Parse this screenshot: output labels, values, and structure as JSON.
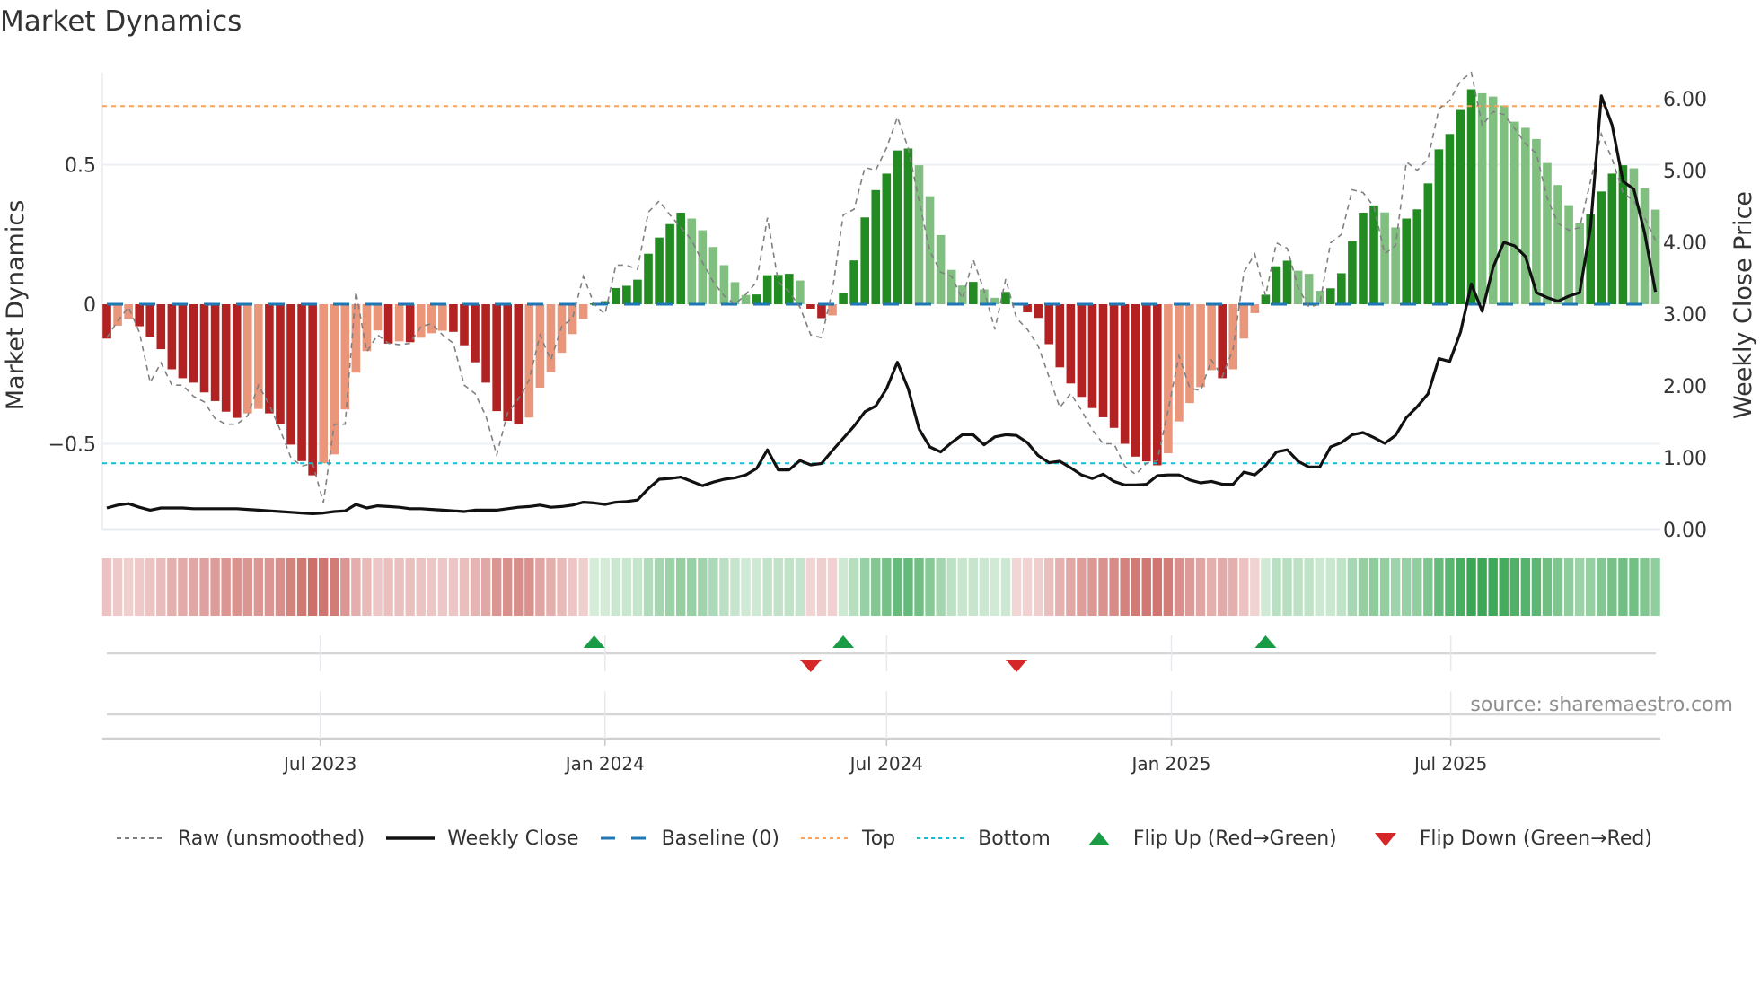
{
  "title": "Market Dynamics",
  "source": "source: sharemaestro.com",
  "colors": {
    "bar_neg_strong": "#b22222",
    "bar_neg_weak": "#e9967a",
    "bar_pos_strong": "#228b22",
    "bar_pos_weak": "#80bf80",
    "raw": "#808080",
    "close": "#111111",
    "baseline": "#1f77b4",
    "top": "#f4a460",
    "bottom": "#17becf",
    "flip_up": "#1a9c47",
    "flip_down": "#d62728"
  },
  "legend": [
    {
      "key": "raw",
      "label": "Raw (unsmoothed)"
    },
    {
      "key": "close",
      "label": "Weekly Close"
    },
    {
      "key": "baseline",
      "label": "Baseline (0)"
    },
    {
      "key": "top",
      "label": "Top"
    },
    {
      "key": "bottom",
      "label": "Bottom"
    },
    {
      "key": "flip_up",
      "label": "Flip Up (Red→Green)"
    },
    {
      "key": "flip_down",
      "label": "Flip Down (Green→Red)"
    }
  ],
  "chart_data": {
    "type": "bar",
    "title": "Market Dynamics",
    "start_date": "2023-02-13",
    "frequency": "weekly",
    "ylabel": "Market Dynamics",
    "y2label": "Weekly Close Price",
    "ylim": [
      -0.8,
      0.83
    ],
    "y2lim": [
      0,
      6.4
    ],
    "yticks": [
      {
        "v": 0.5,
        "label": "0.5"
      },
      {
        "v": 0,
        "label": "0"
      },
      {
        "v": -0.5,
        "label": "−0.5"
      }
    ],
    "y2ticks": [
      {
        "v": 6,
        "label": "6.00"
      },
      {
        "v": 5,
        "label": "5.00"
      },
      {
        "v": 4,
        "label": "4.00"
      },
      {
        "v": 3,
        "label": "3.00"
      },
      {
        "v": 2,
        "label": "2.00"
      },
      {
        "v": 1,
        "label": "1.00"
      },
      {
        "v": 0,
        "label": "0.00"
      }
    ],
    "xticks": [
      {
        "week": 19.71,
        "label": "Jul 2023"
      },
      {
        "week": 46.0,
        "label": "Jan 2024"
      },
      {
        "week": 72.0,
        "label": "Jul 2024"
      },
      {
        "week": 98.3,
        "label": "Jan 2025"
      },
      {
        "week": 124.1,
        "label": "Jul 2025"
      }
    ],
    "reference_lines": {
      "baseline": 0,
      "top": 0.71,
      "bottom": -0.57
    },
    "momentum": [
      -0.123,
      -0.077,
      -0.053,
      -0.079,
      -0.116,
      -0.161,
      -0.233,
      -0.265,
      -0.281,
      -0.316,
      -0.347,
      -0.385,
      -0.407,
      -0.391,
      -0.375,
      -0.391,
      -0.43,
      -0.503,
      -0.562,
      -0.613,
      -0.57,
      -0.538,
      -0.377,
      -0.245,
      -0.168,
      -0.094,
      -0.141,
      -0.133,
      -0.136,
      -0.12,
      -0.104,
      -0.095,
      -0.099,
      -0.147,
      -0.208,
      -0.281,
      -0.383,
      -0.418,
      -0.429,
      -0.406,
      -0.299,
      -0.243,
      -0.174,
      -0.107,
      -0.053,
      0.003,
      0.011,
      0.058,
      0.066,
      0.088,
      0.181,
      0.239,
      0.287,
      0.328,
      0.307,
      0.265,
      0.205,
      0.14,
      0.079,
      0.033,
      0.035,
      0.104,
      0.105,
      0.109,
      0.085,
      -0.016,
      -0.05,
      -0.04,
      0.04,
      0.157,
      0.311,
      0.409,
      0.468,
      0.551,
      0.558,
      0.498,
      0.387,
      0.248,
      0.123,
      0.067,
      0.08,
      0.053,
      0.023,
      0.044,
      -0.003,
      -0.029,
      -0.049,
      -0.143,
      -0.226,
      -0.284,
      -0.332,
      -0.372,
      -0.405,
      -0.443,
      -0.5,
      -0.546,
      -0.563,
      -0.577,
      -0.534,
      -0.42,
      -0.354,
      -0.297,
      -0.236,
      -0.265,
      -0.233,
      -0.123,
      -0.032,
      0.034,
      0.136,
      0.156,
      0.12,
      0.109,
      0.048,
      0.057,
      0.111,
      0.226,
      0.328,
      0.354,
      0.329,
      0.275,
      0.307,
      0.34,
      0.433,
      0.555,
      0.61,
      0.696,
      0.77,
      0.756,
      0.744,
      0.712,
      0.654,
      0.632,
      0.592,
      0.506,
      0.427,
      0.355,
      0.29,
      0.322,
      0.404,
      0.468,
      0.498,
      0.487,
      0.415,
      0.339
    ],
    "raw": [
      -0.12,
      -0.06,
      -0.01,
      -0.1,
      -0.28,
      -0.21,
      -0.29,
      -0.29,
      -0.33,
      -0.35,
      -0.41,
      -0.43,
      -0.43,
      -0.4,
      -0.29,
      -0.36,
      -0.45,
      -0.55,
      -0.58,
      -0.57,
      -0.71,
      -0.43,
      -0.43,
      0.045,
      -0.17,
      -0.11,
      -0.14,
      -0.145,
      -0.14,
      -0.08,
      -0.07,
      -0.11,
      -0.14,
      -0.29,
      -0.32,
      -0.4,
      -0.54,
      -0.39,
      -0.34,
      -0.27,
      -0.11,
      -0.2,
      -0.08,
      -0.05,
      0.1,
      0.0,
      -0.035,
      0.14,
      0.14,
      0.125,
      0.33,
      0.37,
      0.32,
      0.275,
      0.23,
      0.15,
      0.08,
      0.03,
      0.0,
      0.035,
      0.08,
      0.31,
      0.08,
      0.045,
      -0.01,
      -0.11,
      -0.12,
      0.05,
      0.32,
      0.34,
      0.49,
      0.48,
      0.56,
      0.67,
      0.56,
      0.37,
      0.19,
      0.115,
      0.1,
      0.02,
      0.16,
      0.05,
      -0.09,
      0.09,
      -0.05,
      -0.09,
      -0.15,
      -0.26,
      -0.37,
      -0.32,
      -0.38,
      -0.45,
      -0.5,
      -0.5,
      -0.58,
      -0.61,
      -0.57,
      -0.56,
      -0.38,
      -0.185,
      -0.3,
      -0.31,
      -0.2,
      -0.26,
      -0.16,
      0.115,
      0.18,
      0.03,
      0.22,
      0.2,
      0.06,
      -0.01,
      0.0,
      0.22,
      0.25,
      0.41,
      0.4,
      0.35,
      0.18,
      0.21,
      0.51,
      0.48,
      0.52,
      0.7,
      0.73,
      0.8,
      0.83,
      0.64,
      0.69,
      0.68,
      0.63,
      0.575,
      0.54,
      0.38,
      0.29,
      0.265,
      0.275,
      0.44,
      0.61,
      0.52,
      0.4,
      0.37,
      0.31,
      0.23
    ],
    "weekly_close": [
      0.3,
      0.34,
      0.36,
      0.31,
      0.27,
      0.3,
      0.3,
      0.3,
      0.29,
      0.29,
      0.29,
      0.29,
      0.29,
      0.28,
      0.27,
      0.26,
      0.25,
      0.24,
      0.23,
      0.22,
      0.23,
      0.25,
      0.26,
      0.35,
      0.3,
      0.33,
      0.32,
      0.31,
      0.29,
      0.29,
      0.28,
      0.27,
      0.26,
      0.25,
      0.27,
      0.27,
      0.27,
      0.29,
      0.31,
      0.32,
      0.34,
      0.31,
      0.32,
      0.34,
      0.38,
      0.37,
      0.35,
      0.38,
      0.39,
      0.41,
      0.57,
      0.7,
      0.71,
      0.73,
      0.67,
      0.61,
      0.66,
      0.7,
      0.72,
      0.76,
      0.85,
      1.11,
      0.83,
      0.83,
      0.96,
      0.9,
      0.92,
      1.1,
      1.27,
      1.44,
      1.64,
      1.72,
      1.96,
      2.33,
      1.96,
      1.4,
      1.15,
      1.08,
      1.21,
      1.32,
      1.32,
      1.18,
      1.29,
      1.32,
      1.31,
      1.21,
      1.03,
      0.93,
      0.95,
      0.86,
      0.76,
      0.71,
      0.77,
      0.67,
      0.62,
      0.62,
      0.63,
      0.75,
      0.76,
      0.76,
      0.69,
      0.65,
      0.67,
      0.63,
      0.63,
      0.8,
      0.76,
      0.89,
      1.08,
      1.11,
      0.95,
      0.87,
      0.87,
      1.15,
      1.21,
      1.32,
      1.35,
      1.28,
      1.2,
      1.31,
      1.56,
      1.71,
      1.89,
      2.38,
      2.34,
      2.75,
      3.42,
      3.04,
      3.65,
      4.0,
      3.95,
      3.8,
      3.3,
      3.23,
      3.18,
      3.25,
      3.3,
      4.2,
      6.04,
      5.63,
      4.85,
      4.74,
      4.13,
      3.31
    ],
    "flips": [
      {
        "type": "up",
        "week": 45
      },
      {
        "type": "down",
        "week": 65
      },
      {
        "type": "up",
        "week": 68
      },
      {
        "type": "down",
        "week": 84
      },
      {
        "type": "up",
        "week": 107
      }
    ]
  }
}
